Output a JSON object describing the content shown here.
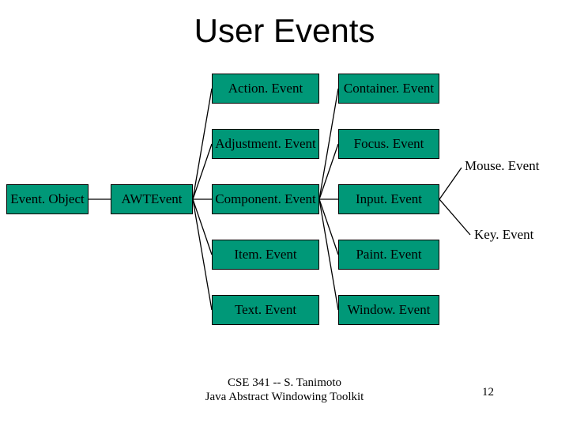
{
  "title": "User Events",
  "boxes": {
    "eventObject": "Event. Object",
    "awtEvent": "AWTEvent",
    "actionEvent": "Action. Event",
    "adjustmentEvent": "Adjustment. Event",
    "componentEvent": "Component. Event",
    "itemEvent": "Item. Event",
    "textEvent": "Text. Event",
    "containerEvent": "Container. Event",
    "focusEvent": "Focus. Event",
    "inputEvent": "Input. Event",
    "paintEvent": "Paint. Event",
    "windowEvent": "Window. Event"
  },
  "sideLabels": {
    "mouseEvent": "Mouse. Event",
    "keyEvent": "Key. Event"
  },
  "footer": {
    "line1": "CSE 341 -- S. Tanimoto",
    "line2": "Java Abstract Windowing Toolkit",
    "page": "12"
  },
  "chart_data": {
    "type": "tree-diagram",
    "title": "User Events",
    "edges": [
      [
        "Event.Object",
        "AWTEvent"
      ],
      [
        "AWTEvent",
        "Action.Event"
      ],
      [
        "AWTEvent",
        "Adjustment.Event"
      ],
      [
        "AWTEvent",
        "Component.Event"
      ],
      [
        "AWTEvent",
        "Item.Event"
      ],
      [
        "AWTEvent",
        "Text.Event"
      ],
      [
        "Component.Event",
        "Container.Event"
      ],
      [
        "Component.Event",
        "Focus.Event"
      ],
      [
        "Component.Event",
        "Input.Event"
      ],
      [
        "Component.Event",
        "Paint.Event"
      ],
      [
        "Component.Event",
        "Window.Event"
      ],
      [
        "Input.Event",
        "Mouse.Event"
      ],
      [
        "Input.Event",
        "Key.Event"
      ]
    ]
  }
}
